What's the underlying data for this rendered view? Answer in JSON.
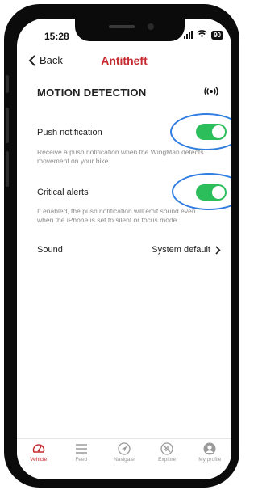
{
  "status_bar": {
    "time": "15:28",
    "battery": "90"
  },
  "nav": {
    "back_label": "Back",
    "title": "Antitheft"
  },
  "section": {
    "title": "MOTION DETECTION",
    "icon": "radio-waves-icon"
  },
  "push_notification": {
    "label": "Push notification",
    "description": "Receive a push notification when the WingMan detects movement on your bike",
    "enabled": true
  },
  "critical_alerts": {
    "label": "Critical alerts",
    "description": "If enabled, the push notification will emit sound even when the iPhone is set to silent or focus mode",
    "enabled": true
  },
  "sound": {
    "label": "Sound",
    "value": "System default"
  },
  "tabs": [
    {
      "label": "Vehicle",
      "icon": "speedometer-icon",
      "active": true
    },
    {
      "label": "Feed",
      "icon": "menu-lines-icon",
      "active": false
    },
    {
      "label": "Navigate",
      "icon": "navigate-arrow-icon",
      "active": false
    },
    {
      "label": "Explore",
      "icon": "compass-icon",
      "active": false
    },
    {
      "label": "My profile",
      "icon": "profile-icon",
      "active": false
    }
  ],
  "colors": {
    "accent": "#c62a2f",
    "toggle_on": "#2dbe5c",
    "annotation_circle": "#2f7de1"
  }
}
